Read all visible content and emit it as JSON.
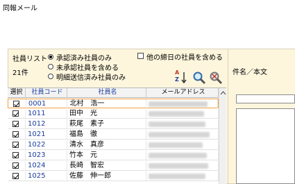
{
  "window": {
    "title": "同報メール"
  },
  "filter": {
    "section_label": "社員リスト",
    "count_label": "21件",
    "radio_options": [
      "承認済み社員のみ",
      "未承認社員を含める",
      "明細送信済み社員のみ"
    ],
    "selected_option": "承認済み社員のみ",
    "include_retired_label": "他の締日の社員を含める",
    "include_retired_checked": false
  },
  "toolbar": {
    "sort_icon_text_a": "A",
    "sort_icon_text_z": "Z"
  },
  "grid": {
    "columns": [
      "選択",
      "社員コード",
      "社員名",
      "メールアドレス"
    ],
    "rows": [
      {
        "checked": true,
        "code": "0001",
        "name": "北村　浩一",
        "selected": true
      },
      {
        "checked": true,
        "code": "1011",
        "name": "田中　光"
      },
      {
        "checked": true,
        "code": "1012",
        "name": "萩尾　素子"
      },
      {
        "checked": true,
        "code": "1021",
        "name": "福島　徹"
      },
      {
        "checked": true,
        "code": "1022",
        "name": "清水　真彦"
      },
      {
        "checked": true,
        "code": "1023",
        "name": "竹本　元"
      },
      {
        "checked": true,
        "code": "1024",
        "name": "長崎　智宏"
      },
      {
        "checked": true,
        "code": "1025",
        "name": "佐藤　伸一郎"
      }
    ]
  },
  "right": {
    "subject_label": "件名／本文"
  },
  "colors": {
    "panel_bg": "#fdf6dd",
    "accent_blue": "#1a3c9c",
    "selection_border": "#f0a040"
  }
}
